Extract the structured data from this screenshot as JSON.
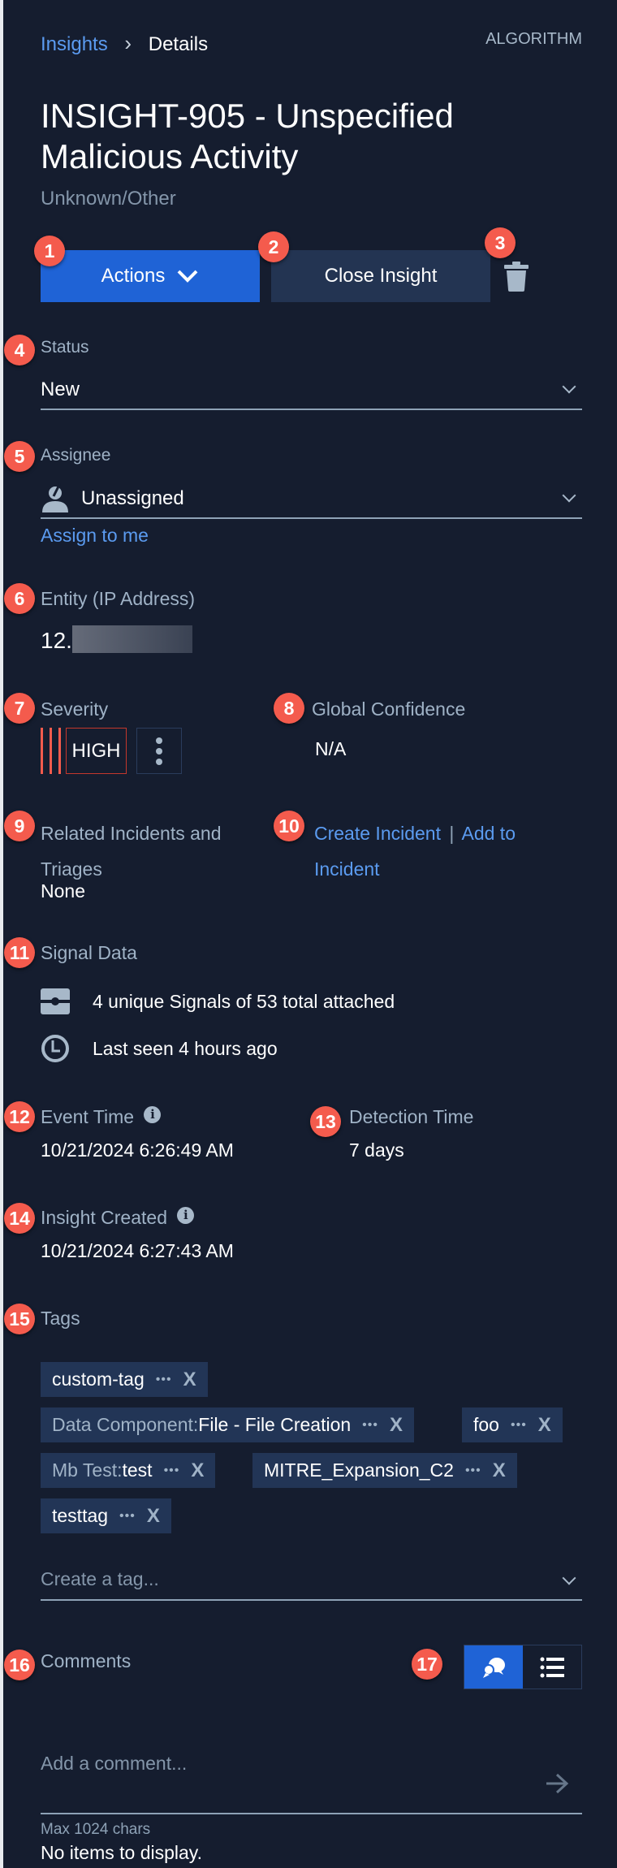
{
  "breadcrumb": {
    "parent": "Insights",
    "separator": "›",
    "current": "Details"
  },
  "source_label": "ALGORITHM",
  "title_line1": "INSIGHT-905 - Unspecified",
  "title_line2": "Malicious Activity",
  "subtitle": "Unknown/Other",
  "actions": {
    "actions_label": "Actions",
    "close_label": "Close Insight",
    "delete_icon": "trash-icon"
  },
  "status": {
    "label": "Status",
    "value": "New"
  },
  "assignee": {
    "label": "Assignee",
    "value": "Unassigned",
    "assign_link": "Assign to me"
  },
  "entity": {
    "label": "Entity (IP Address)",
    "value": "12."
  },
  "severity": {
    "label": "Severity",
    "value": "HIGH",
    "color": "#f45b4d"
  },
  "global_confidence": {
    "label": "Global Confidence",
    "value": "N/A"
  },
  "related": {
    "label_line1": "Related Incidents and",
    "label_line2": "Triages",
    "value": "None"
  },
  "incident_links": {
    "create": "Create Incident",
    "separator": "|",
    "add_line1": "Add to",
    "add_line2": "Incident"
  },
  "signal_data": {
    "label": "Signal Data",
    "signals_text": "4 unique Signals of 53 total attached",
    "last_seen_text": "Last seen 4 hours ago"
  },
  "event_time": {
    "label": "Event Time",
    "value": "10/21/2024 6:26:49 AM"
  },
  "detection_time": {
    "label": "Detection Time",
    "value": "7 days"
  },
  "insight_created": {
    "label": "Insight Created",
    "value": "10/21/2024 6:27:43 AM"
  },
  "tags": {
    "label": "Tags",
    "items": [
      {
        "key": "",
        "value": "custom-tag"
      },
      {
        "key": "Data Component",
        "value": "File - File Creation"
      },
      {
        "key": "",
        "value": "foo"
      },
      {
        "key": "Mb Test",
        "value": "test"
      },
      {
        "key": "",
        "value": "MITRE_Expansion_C2"
      },
      {
        "key": "",
        "value": "testtag"
      }
    ],
    "key_sep": ":",
    "dots": "•••",
    "remove": "X",
    "create_placeholder": "Create a tag..."
  },
  "comments": {
    "label": "Comments",
    "placeholder": "Add a comment...",
    "max_hint": "Max 1024 chars",
    "empty_text": "No items to display."
  },
  "badges": [
    "1",
    "2",
    "3",
    "4",
    "5",
    "6",
    "7",
    "8",
    "9",
    "10",
    "11",
    "12",
    "13",
    "14",
    "15",
    "16",
    "17"
  ],
  "colors": {
    "background": "#151d2f",
    "primary": "#1f63d6",
    "link": "#5b9bf0",
    "badge": "#f45b4d"
  }
}
